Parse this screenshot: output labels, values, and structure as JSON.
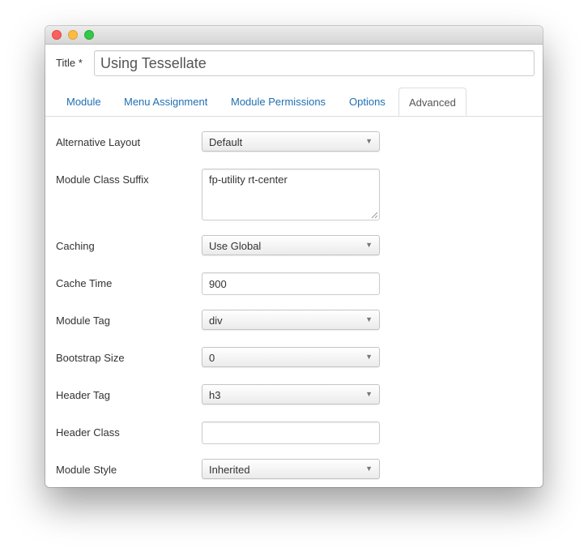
{
  "title_field": {
    "label": "Title *",
    "value": "Using Tessellate"
  },
  "tabs": [
    {
      "label": "Module"
    },
    {
      "label": "Menu Assignment"
    },
    {
      "label": "Module Permissions"
    },
    {
      "label": "Options"
    },
    {
      "label": "Advanced",
      "active": true
    }
  ],
  "fields": {
    "alternative_layout": {
      "label": "Alternative Layout",
      "value": "Default"
    },
    "module_class_suffix": {
      "label": "Module Class Suffix",
      "value": "fp-utility rt-center"
    },
    "caching": {
      "label": "Caching",
      "value": "Use Global"
    },
    "cache_time": {
      "label": "Cache Time",
      "value": "900"
    },
    "module_tag": {
      "label": "Module Tag",
      "value": "div"
    },
    "bootstrap_size": {
      "label": "Bootstrap Size",
      "value": "0"
    },
    "header_tag": {
      "label": "Header Tag",
      "value": "h3"
    },
    "header_class": {
      "label": "Header Class",
      "value": ""
    },
    "module_style": {
      "label": "Module Style",
      "value": "Inherited"
    }
  },
  "icons": {
    "dropdown": "chevron-down-icon",
    "resize": "resize-grip-icon"
  },
  "colors": {
    "tab_link": "#1f6fb3",
    "close": "#fc605c",
    "minimize": "#fdbc40",
    "maximize": "#34c84a"
  }
}
